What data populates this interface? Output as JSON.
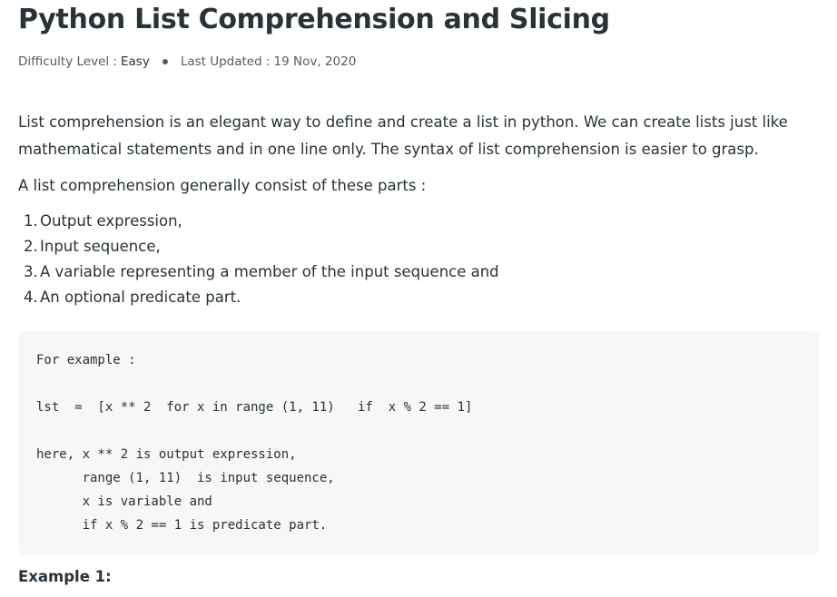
{
  "article": {
    "title": "Python List Comprehension and Slicing",
    "meta": {
      "difficulty_label": "Difficulty Level : ",
      "difficulty_value": "Easy",
      "updated_label": "Last Updated : ",
      "updated_value": "19 Nov, 2020"
    },
    "paragraphs": [
      "List comprehension is an elegant way to define and create a list in python. We can create lists just like mathematical statements and in one line only. The syntax of list comprehension is easier to grasp.",
      "A list comprehension generally consist of these parts :"
    ],
    "list": [
      {
        "num": "1.",
        "text": "Output expression,"
      },
      {
        "num": "2.",
        "text": "Input sequence,"
      },
      {
        "num": "3.",
        "text": "A variable representing a member of the input sequence and"
      },
      {
        "num": "4.",
        "text": "An optional predicate part."
      }
    ],
    "code_lines": [
      "For example :",
      "lst  =  [x ** 2  for x in range (1, 11)   if  x % 2 == 1]",
      "here, x ** 2 is output expression,",
      "      range (1, 11)  is input sequence,",
      "      x is variable and",
      "      if x % 2 == 1 is predicate part."
    ],
    "example_heading": "Example 1:"
  },
  "colors": {
    "text": "#273239",
    "meta_text": "#5a5a5a",
    "code_background": "#f7f7f7"
  }
}
